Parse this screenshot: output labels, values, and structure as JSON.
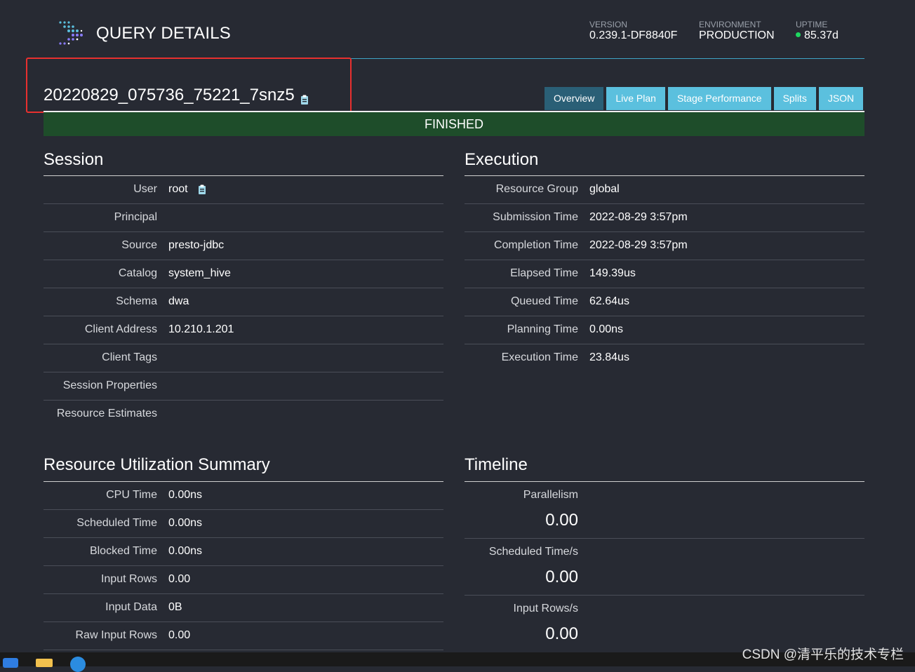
{
  "header": {
    "title": "QUERY DETAILS",
    "stats": {
      "version_label": "VERSION",
      "version_value": "0.239.1-DF8840F",
      "environment_label": "ENVIRONMENT",
      "environment_value": "PRODUCTION",
      "uptime_label": "UPTIME",
      "uptime_value": "85.37d"
    },
    "colors": {
      "accent": "#3ea4c5",
      "uptime_dot": "#1ed760"
    }
  },
  "query": {
    "id": "20220829_075736_75221_7snz5",
    "copy_icon": "clipboard-icon",
    "highlight_color": "#e8302f"
  },
  "tabs": [
    {
      "label": "Overview",
      "active": true
    },
    {
      "label": "Live Plan",
      "active": false
    },
    {
      "label": "Stage Performance",
      "active": false
    },
    {
      "label": "Splits",
      "active": false
    },
    {
      "label": "JSON",
      "active": false
    }
  ],
  "status": {
    "label": "FINISHED",
    "color": "#1e4d2a"
  },
  "session": {
    "title": "Session",
    "rows": [
      {
        "key": "User",
        "value": "root"
      },
      {
        "key": "Principal",
        "value": ""
      },
      {
        "key": "Source",
        "value": "presto-jdbc"
      },
      {
        "key": "Catalog",
        "value": "system_hive"
      },
      {
        "key": "Schema",
        "value": "dwa"
      },
      {
        "key": "Client Address",
        "value": "10.210.1.201"
      },
      {
        "key": "Client Tags",
        "value": ""
      },
      {
        "key": "Session Properties",
        "value": ""
      },
      {
        "key": "Resource Estimates",
        "value": ""
      }
    ]
  },
  "execution": {
    "title": "Execution",
    "rows": [
      {
        "key": "Resource Group",
        "value": "global"
      },
      {
        "key": "Submission Time",
        "value": "2022-08-29 3:57pm"
      },
      {
        "key": "Completion Time",
        "value": "2022-08-29 3:57pm"
      },
      {
        "key": "Elapsed Time",
        "value": "149.39us"
      },
      {
        "key": "Queued Time",
        "value": "62.64us"
      },
      {
        "key": "Planning Time",
        "value": "0.00ns"
      },
      {
        "key": "Execution Time",
        "value": "23.84us"
      }
    ]
  },
  "resource_utilization": {
    "title": "Resource Utilization Summary",
    "rows": [
      {
        "key": "CPU Time",
        "value": "0.00ns"
      },
      {
        "key": "Scheduled Time",
        "value": "0.00ns"
      },
      {
        "key": "Blocked Time",
        "value": "0.00ns"
      },
      {
        "key": "Input Rows",
        "value": "0.00"
      },
      {
        "key": "Input Data",
        "value": "0B"
      },
      {
        "key": "Raw Input Rows",
        "value": "0.00"
      }
    ]
  },
  "timeline": {
    "title": "Timeline",
    "items": [
      {
        "key": "Parallelism",
        "value": "0.00"
      },
      {
        "key": "Scheduled Time/s",
        "value": "0.00"
      },
      {
        "key": "Input Rows/s",
        "value": "0.00"
      }
    ]
  },
  "watermark": "CSDN @清平乐的技术专栏"
}
